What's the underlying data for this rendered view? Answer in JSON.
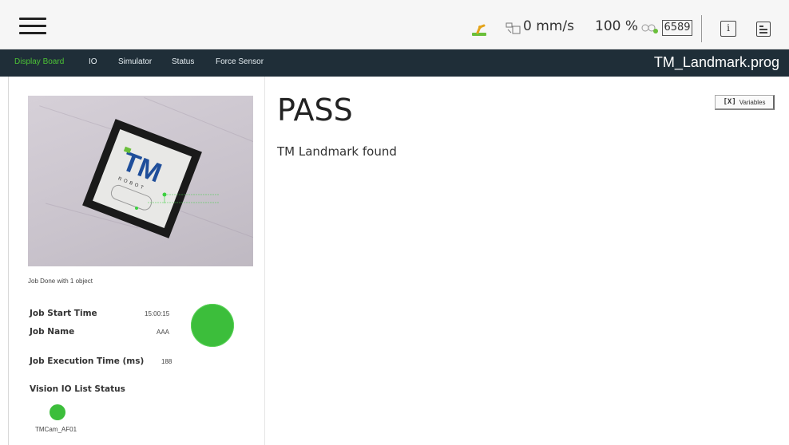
{
  "topbar": {
    "speed": "0 mm/s",
    "speed_percent": "100 %",
    "counter": "6589",
    "info_glyph": "i"
  },
  "nav": {
    "tabs": [
      {
        "label": "Display Board",
        "active": true
      },
      {
        "label": "IO",
        "active": false
      },
      {
        "label": "Simulator",
        "active": false
      },
      {
        "label": "Status",
        "active": false
      },
      {
        "label": "Force Sensor",
        "active": false
      }
    ],
    "program_title": "TM_Landmark.prog"
  },
  "left_panel": {
    "camera_caption": "Job Done with 1 object",
    "job_start_time_label": "Job Start Time",
    "job_start_time_value": "15:00:15",
    "job_name_label": "Job Name",
    "job_name_value": "AAA",
    "job_exec_time_label": "Job Execution Time (ms)",
    "job_exec_time_value": "188",
    "vision_io_label": "Vision IO List Status",
    "vision_io_item": "TMCam_AF01",
    "camera_logo_text": "TM",
    "camera_logo_subtext": "ROBOT"
  },
  "main": {
    "result": "PASS",
    "message": "TM Landmark found",
    "variables_button": {
      "glyph": "[X]",
      "label": "Variables"
    }
  },
  "colors": {
    "nav_bg": "#1f2e38",
    "active_tab": "#4cc235",
    "status_green": "#3cbe3b"
  }
}
